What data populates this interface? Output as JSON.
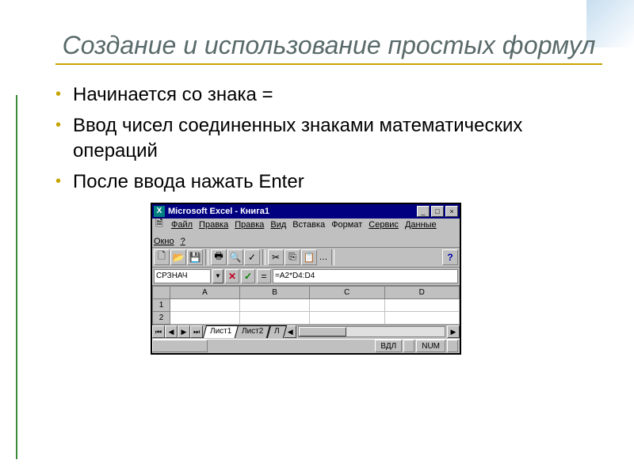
{
  "slide": {
    "title": "Создание и использование простых формул",
    "bullets": [
      "Начинается со знака =",
      "Ввод чисел соединенных знаками математических операций",
      "После ввода нажать Enter"
    ]
  },
  "excel": {
    "titlebar": "Microsoft Excel - Книга1",
    "menu": [
      "Файл",
      "Правка",
      "Правка",
      "Вид",
      "Вставка",
      "Формат",
      "Сервис",
      "Данные",
      "Окно",
      "?"
    ],
    "namebox": "СРЗНАЧ",
    "formula": "=A2*D4:D4",
    "columns": [
      "A",
      "B",
      "C",
      "D"
    ],
    "rows": [
      "1",
      "2"
    ],
    "tabs": [
      "Лист1",
      "Лист2",
      "Л"
    ],
    "status_left": "",
    "status_mid": "ВДЛ",
    "status_num": "NUM",
    "icons": {
      "min": "_",
      "max": "□",
      "close": "×",
      "doc": "🗎",
      "new": "🗋",
      "open": "📂",
      "save": "💾",
      "print": "🖶",
      "preview": "🔍",
      "spell": "✓",
      "cut": "✂",
      "copy": "⎘",
      "paste": "📋",
      "help": "?",
      "dropdown": "▼",
      "cancel": "✕",
      "accept": "✓",
      "eq": "=",
      "nav_first": "⏮",
      "nav_prev": "◀",
      "nav_next": "▶",
      "nav_last": "⏭",
      "scroll_left": "◀",
      "scroll_right": "▶"
    }
  }
}
